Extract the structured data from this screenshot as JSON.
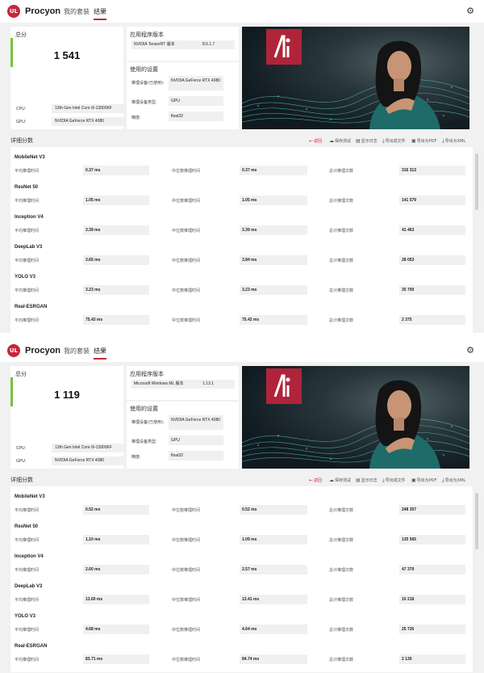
{
  "app": {
    "logo_text": "UL",
    "name": "Procyon",
    "tabs": [
      "我的套装",
      "结果"
    ],
    "active_tab": 1,
    "accent_color": "#c6263a",
    "score_bar_color": "#78c13a"
  },
  "labels": {
    "total_score": "总分",
    "cpu": "CPU:",
    "gpu": "GPU:",
    "app_version": "应用程序版本",
    "settings": "使用的设置",
    "inference_device": "推理设备(已使用):",
    "inference_device_type": "推理设备类型:",
    "precision": "精度:",
    "detailed_scores": "详细分数",
    "avg_time": "平均推理时间",
    "median_time": "中位数推理时间",
    "total_count": "总计推理次数"
  },
  "toolbar": {
    "back": "返回",
    "save_test": "保存测试",
    "show_log": "显示日志",
    "export_results": "导出成文件",
    "export_pdf": "导出为PDF",
    "export_xml": "导出为XML"
  },
  "runs": [
    {
      "score": "1 541",
      "cpu": "13th Gen Intel Core i9-13900KF",
      "gpu": "NVIDIA GeForce RTX 4080",
      "app_version_name": "NVIDIA TensorRT 版本",
      "app_version_value": "8.5.1.7",
      "inference_device": "NVIDIA GeForce RTX 4080",
      "inference_device_type": "GPU",
      "precision": "float32",
      "models": [
        {
          "name": "MobileNet V3",
          "avg": "0.37 ms",
          "median": "0.37 ms",
          "count": "316 313"
        },
        {
          "name": "ResNet 50",
          "avg": "1.05 ms",
          "median": "1.05 ms",
          "count": "141 579"
        },
        {
          "name": "Inception V4",
          "avg": "3.39 ms",
          "median": "3.39 ms",
          "count": "41 463"
        },
        {
          "name": "DeepLab V3",
          "avg": "3.65 ms",
          "median": "3.84 ms",
          "count": "28 053"
        },
        {
          "name": "YOLO V3",
          "avg": "3.23 ms",
          "median": "3.23 ms",
          "count": "35 700"
        },
        {
          "name": "Real-ESRGAN",
          "avg": "75.43 ms",
          "median": "75.42 ms",
          "count": "2 375"
        }
      ]
    },
    {
      "score": "1 119",
      "cpu": "13th Gen Intel Core i9-13900KF",
      "gpu": "NVIDIA GeForce RTX 4080",
      "app_version_name": "Microsoft Windows ML 版本",
      "app_version_value": "1.13.1",
      "inference_device": "NVIDIA GeForce RTX 4080",
      "inference_device_type": "GPU",
      "precision": "float32",
      "models": [
        {
          "name": "MobileNet V3",
          "avg": "0.52 ms",
          "median": "0.52 ms",
          "count": "248 357"
        },
        {
          "name": "ResNet 50",
          "avg": "1.10 ms",
          "median": "1.09 ms",
          "count": "135 565"
        },
        {
          "name": "Inception V4",
          "avg": "2.60 ms",
          "median": "2.57 ms",
          "count": "47 379"
        },
        {
          "name": "DeepLab V3",
          "avg": "13.60 ms",
          "median": "13.41 ms",
          "count": "10 218"
        },
        {
          "name": "YOLO V3",
          "avg": "4.68 ms",
          "median": "4.64 ms",
          "count": "25 726"
        },
        {
          "name": "Real-ESRGAN",
          "avg": "83.71 ms",
          "median": "84.74 ms",
          "count": "2 130"
        }
      ]
    }
  ]
}
